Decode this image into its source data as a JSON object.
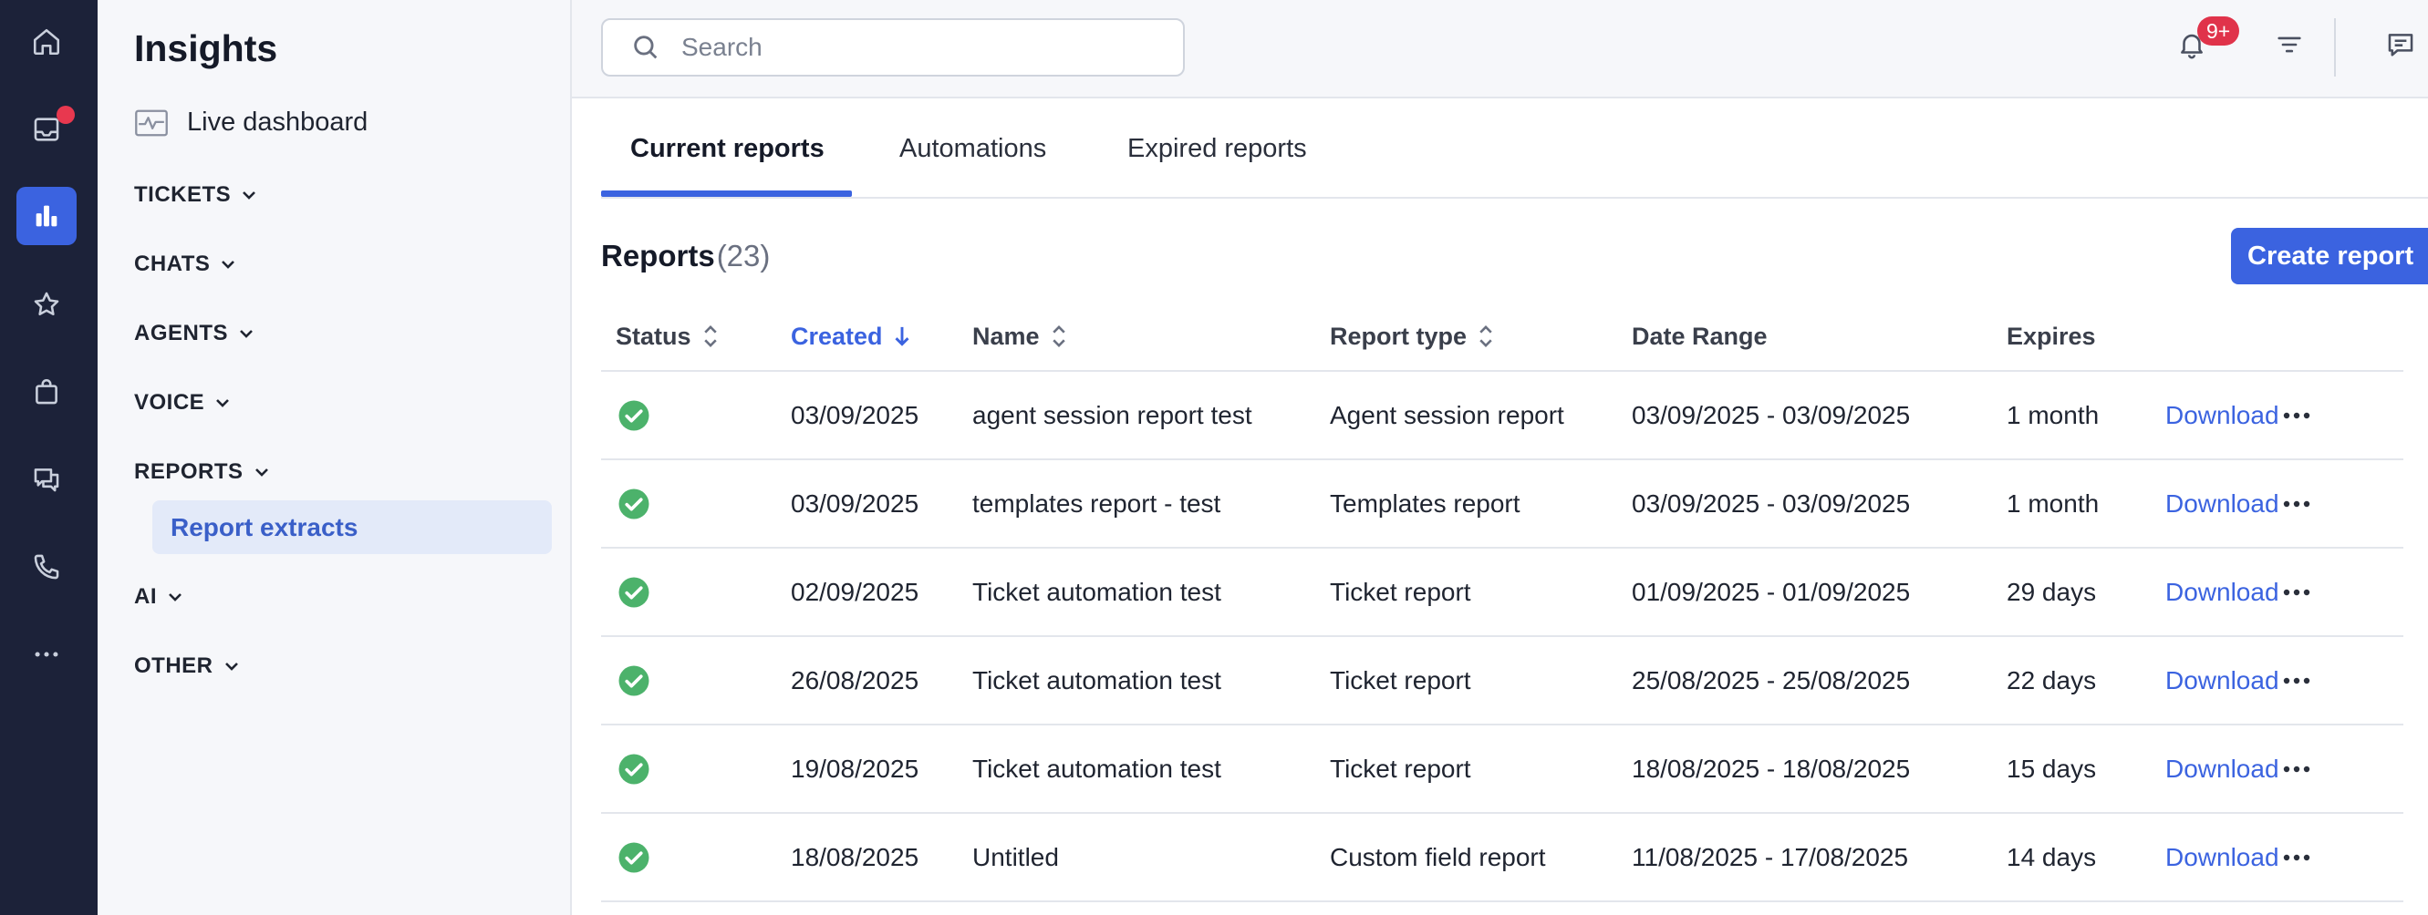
{
  "rail": {
    "items": [
      {
        "icon": "home-icon",
        "active": false
      },
      {
        "icon": "inbox-icon",
        "active": false,
        "notification_dot": true
      },
      {
        "icon": "bar-chart-icon",
        "active": true
      },
      {
        "icon": "star-icon",
        "active": false
      },
      {
        "icon": "shopping-bag-icon",
        "active": false
      },
      {
        "icon": "chat-bubbles-icon",
        "active": false
      },
      {
        "icon": "phone-icon",
        "active": false
      },
      {
        "icon": "more-horizontal-icon",
        "active": false
      }
    ]
  },
  "nav": {
    "title": "Insights",
    "live_dashboard": "Live dashboard",
    "sections": [
      {
        "label": "TICKETS"
      },
      {
        "label": "CHATS"
      },
      {
        "label": "AGENTS"
      },
      {
        "label": "VOICE"
      },
      {
        "label": "REPORTS"
      },
      {
        "label": "AI"
      },
      {
        "label": "OTHER"
      }
    ],
    "active_sub_item": "Report extracts"
  },
  "topbar": {
    "search_placeholder": "Search",
    "notification_badge": "9+"
  },
  "tabs": [
    {
      "label": "Current reports",
      "active": true
    },
    {
      "label": "Automations",
      "active": false
    },
    {
      "label": "Expired reports",
      "active": false
    }
  ],
  "reports": {
    "title": "Reports",
    "count": "(23)",
    "create_label": "Create report"
  },
  "table": {
    "headers": {
      "status": "Status",
      "created": "Created",
      "name": "Name",
      "report_type": "Report type",
      "date_range": "Date Range",
      "expires": "Expires"
    },
    "sorted_column": "created",
    "download_label": "Download",
    "rows": [
      {
        "status": "complete",
        "created": "03/09/2025",
        "name": "agent session report test",
        "type": "Agent session report",
        "range": "03/09/2025 - 03/09/2025",
        "expires": "1 month"
      },
      {
        "status": "complete",
        "created": "03/09/2025",
        "name": "templates report - test",
        "type": "Templates report",
        "range": "03/09/2025 - 03/09/2025",
        "expires": "1 month"
      },
      {
        "status": "complete",
        "created": "02/09/2025",
        "name": "Ticket automation test",
        "type": "Ticket report",
        "range": "01/09/2025 - 01/09/2025",
        "expires": "29 days"
      },
      {
        "status": "complete",
        "created": "26/08/2025",
        "name": "Ticket automation test",
        "type": "Ticket report",
        "range": "25/08/2025 - 25/08/2025",
        "expires": "22 days"
      },
      {
        "status": "complete",
        "created": "19/08/2025",
        "name": "Ticket automation test",
        "type": "Ticket report",
        "range": "18/08/2025 - 18/08/2025",
        "expires": "15 days"
      },
      {
        "status": "complete",
        "created": "18/08/2025",
        "name": "Untitled",
        "type": "Custom field report",
        "range": "11/08/2025 - 17/08/2025",
        "expires": "14 days"
      }
    ]
  },
  "colors": {
    "rail_bg": "#1c2239",
    "accent": "#3b63e0",
    "success": "#4cb26b",
    "danger": "#e0334a"
  }
}
